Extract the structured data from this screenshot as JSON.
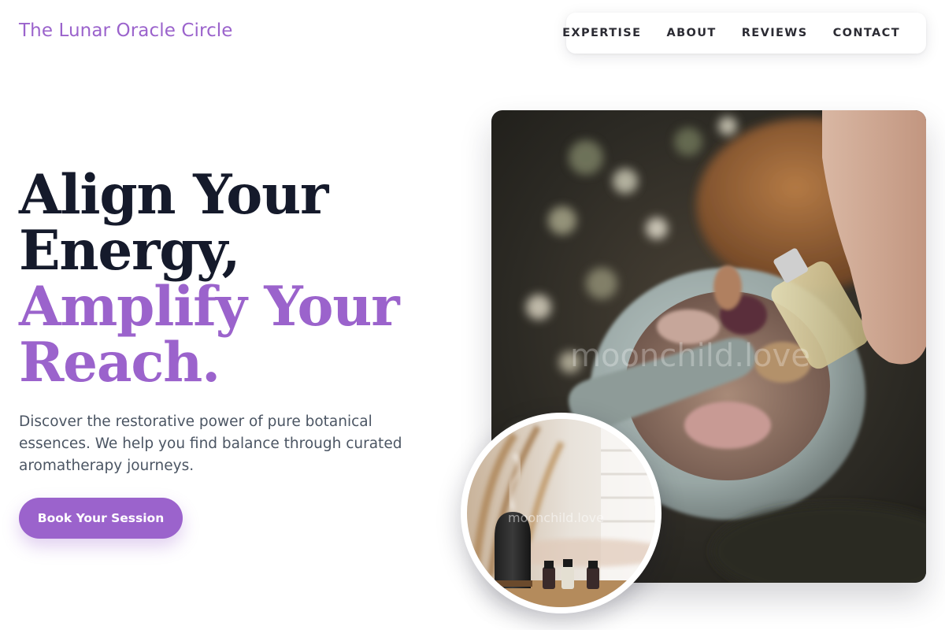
{
  "brand": {
    "name": "The Lunar Oracle Circle"
  },
  "nav": {
    "items": [
      "EXPERTISE",
      "ABOUT",
      "REVIEWS",
      "CONTACT"
    ]
  },
  "hero": {
    "headline_dark_1": "Align Your",
    "headline_dark_2": "Energy,",
    "headline_accent_1": "Amplify Your",
    "headline_accent_2": "Reach.",
    "lead": "Discover the restorative power of pure botanical essences. We help you find balance through curated aromatherapy journeys.",
    "cta_label": "Book Your Session"
  },
  "images": {
    "main_watermark": "moonchild.love",
    "inset_watermark": "moonchild.love"
  },
  "colors": {
    "accent": "#9b63cc",
    "heading": "#151a2b",
    "body": "#4b5563"
  }
}
